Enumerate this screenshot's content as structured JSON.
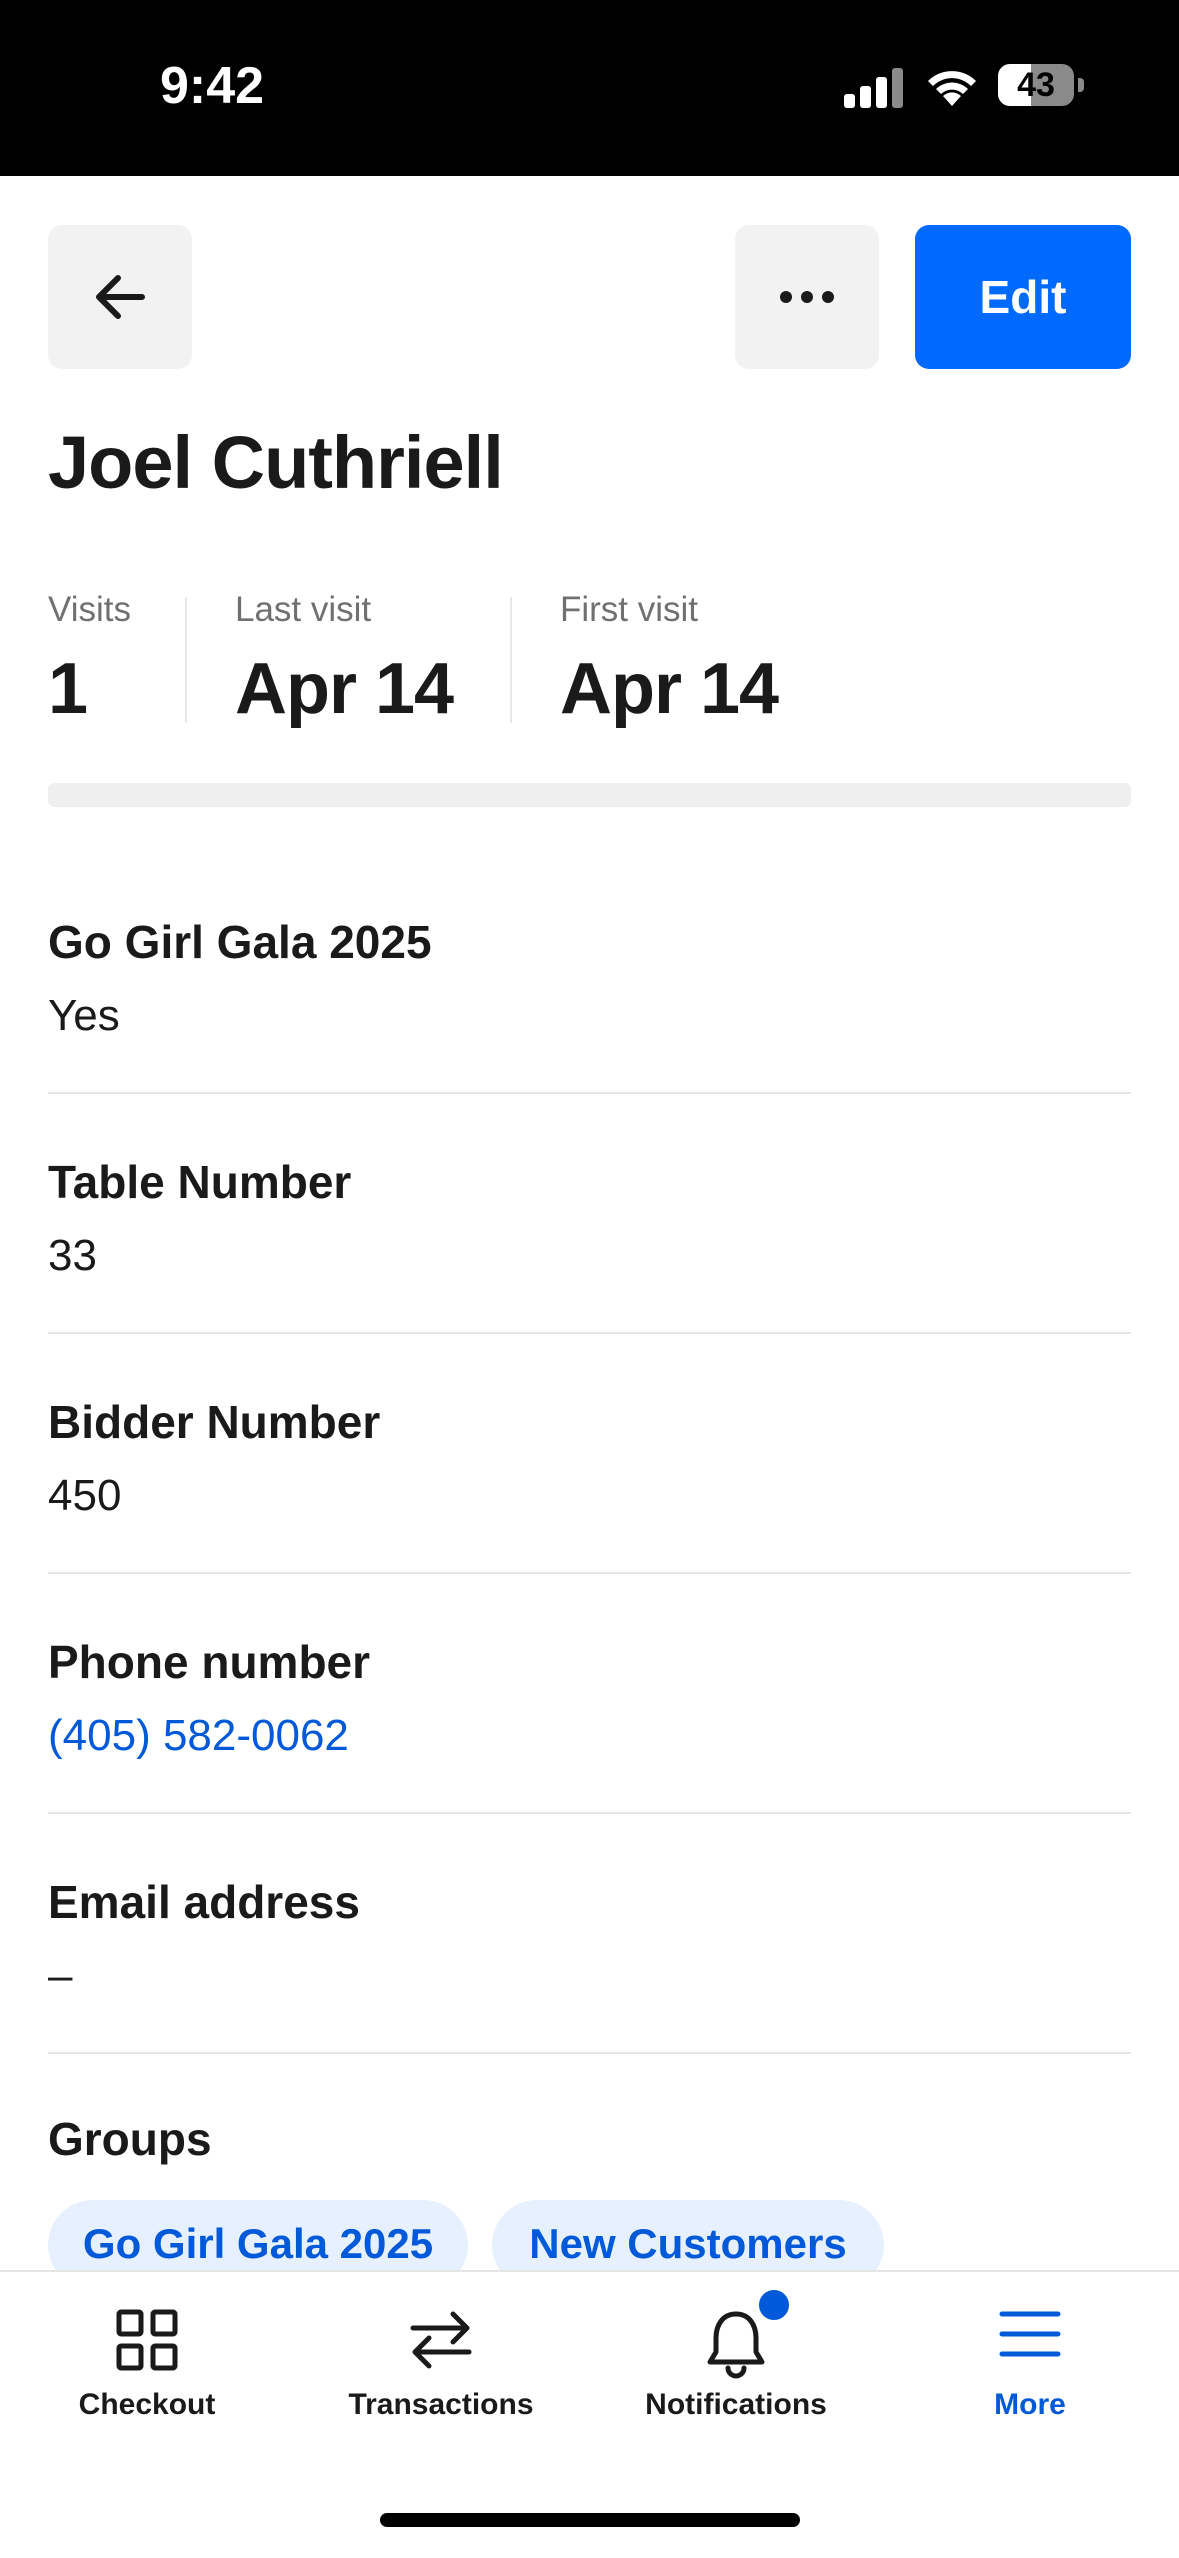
{
  "status_bar": {
    "time": "9:42",
    "battery": "43",
    "battery_level": 0.43
  },
  "header": {
    "edit_label": "Edit"
  },
  "customer": {
    "name": "Joel Cuthriell"
  },
  "stats": [
    {
      "label": "Visits",
      "value": "1"
    },
    {
      "label": "Last visit",
      "value": "Apr 14"
    },
    {
      "label": "First visit",
      "value": "Apr 14"
    }
  ],
  "fields": [
    {
      "label": "Go Girl Gala 2025",
      "value": "Yes"
    },
    {
      "label": "Table Number",
      "value": "33"
    },
    {
      "label": "Bidder Number",
      "value": "450"
    },
    {
      "label": "Phone number",
      "value": "(405) 582-0062"
    },
    {
      "label": "Email address",
      "value": "–"
    }
  ],
  "groups": {
    "label": "Groups",
    "chips": [
      "Go Girl Gala 2025",
      "New Customers"
    ]
  },
  "tabs": [
    {
      "label": "Checkout",
      "icon": "grid-icon"
    },
    {
      "label": "Transactions",
      "icon": "arrows-icon"
    },
    {
      "label": "Notifications",
      "icon": "bell-icon"
    },
    {
      "label": "More",
      "icon": "menu-icon",
      "active": true
    }
  ],
  "colors": {
    "accent": "#006aff",
    "link": "#0059d9",
    "chip_bg": "#e6f0ff"
  }
}
